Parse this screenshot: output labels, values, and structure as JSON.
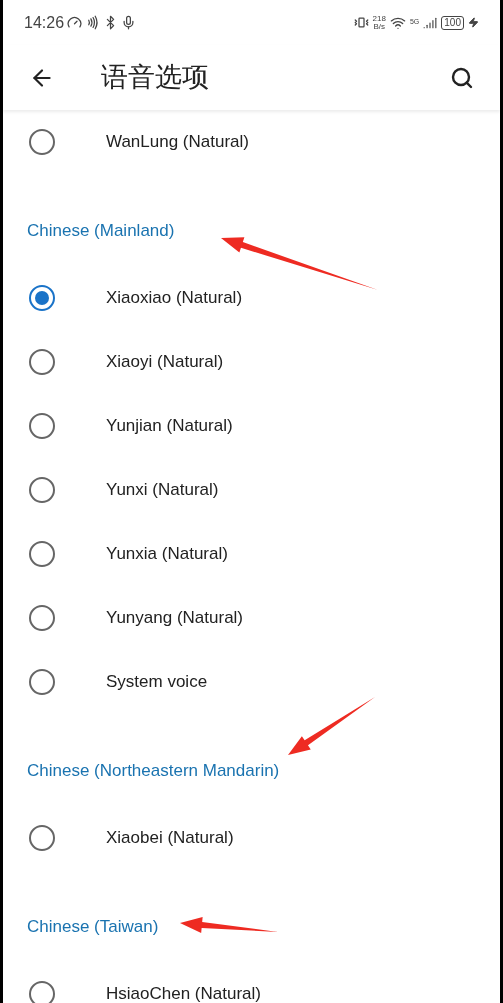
{
  "status_bar": {
    "time": "14:26",
    "net_speed": "218",
    "net_unit": "B/s",
    "network": "5G",
    "battery": "100"
  },
  "app_bar": {
    "title": "语音选项"
  },
  "sections": [
    {
      "items": [
        {
          "label": "WanLung (Natural)",
          "selected": false
        }
      ]
    },
    {
      "header": "Chinese (Mainland)",
      "items": [
        {
          "label": "Xiaoxiao (Natural)",
          "selected": true
        },
        {
          "label": "Xiaoyi (Natural)",
          "selected": false
        },
        {
          "label": "Yunjian (Natural)",
          "selected": false
        },
        {
          "label": "Yunxi (Natural)",
          "selected": false
        },
        {
          "label": "Yunxia (Natural)",
          "selected": false
        },
        {
          "label": "Yunyang (Natural)",
          "selected": false
        },
        {
          "label": "System voice",
          "selected": false
        }
      ]
    },
    {
      "header": "Chinese (Northeastern Mandarin)",
      "items": [
        {
          "label": "Xiaobei (Natural)",
          "selected": false
        }
      ]
    },
    {
      "header": "Chinese (Taiwan)",
      "items": [
        {
          "label": "HsiaoChen (Natural)",
          "selected": false
        }
      ]
    }
  ]
}
